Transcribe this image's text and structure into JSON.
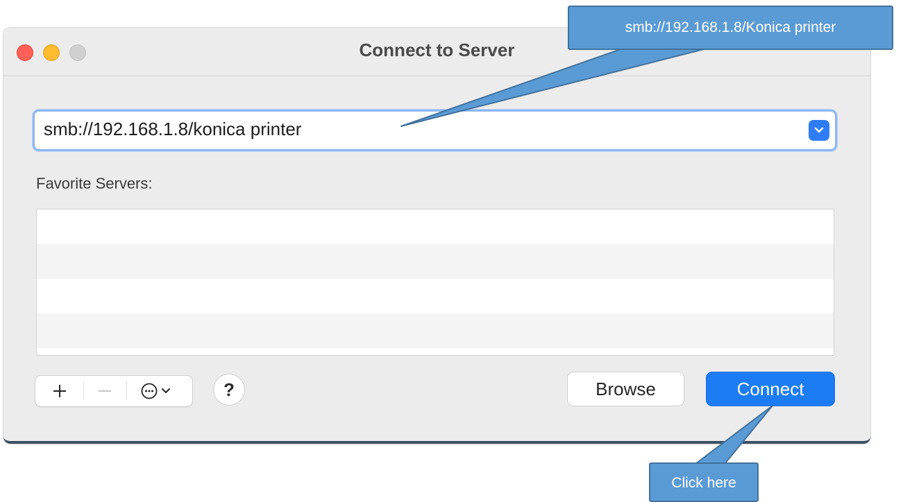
{
  "window": {
    "title": "Connect to Server"
  },
  "address": {
    "value": "smb://192.168.1.8/konica printer",
    "dropdown_icon": "chevron-down-icon"
  },
  "favorites": {
    "label": "Favorite Servers:",
    "rows": [
      "",
      "",
      "",
      ""
    ]
  },
  "toolbar": {
    "add_icon": "plus-icon",
    "remove_icon": "minus-icon",
    "actions_icon": "ellipsis-circle-icon",
    "help_label": "?"
  },
  "buttons": {
    "browse": "Browse",
    "connect": "Connect"
  },
  "annotations": {
    "top": "smb://192.168.1.8/Konica printer",
    "bottom": "Click here",
    "color": "#5b9bd5"
  }
}
